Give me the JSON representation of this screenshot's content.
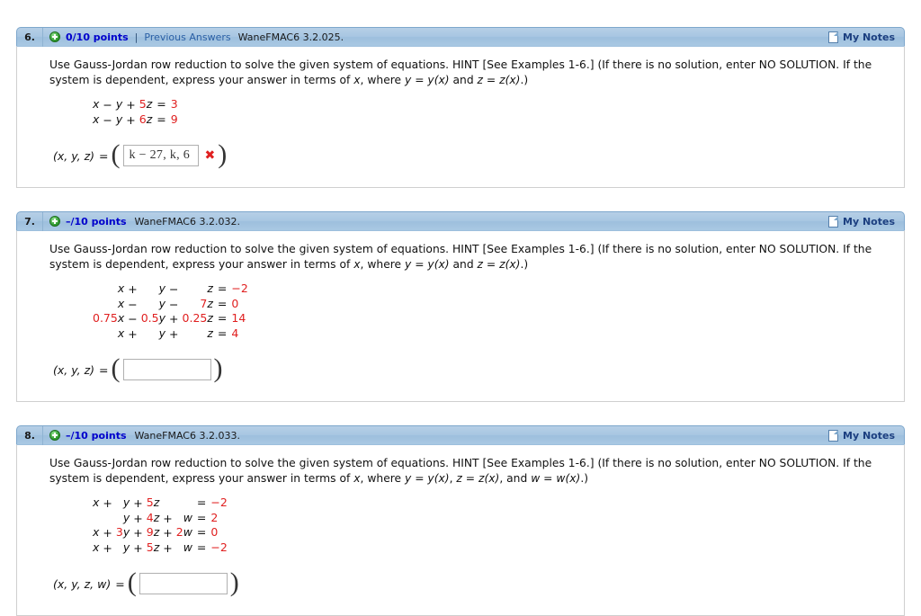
{
  "colors": {
    "header_blue": "#a8c6e2",
    "points_blue": "#0000cc",
    "link_blue": "#2a5fa5",
    "equation_red": "#e02020",
    "notes_blue": "#1c3f80"
  },
  "problems": [
    {
      "number": "6.",
      "points": "0/10 points",
      "separator": "|",
      "previous_answers": "Previous Answers",
      "question_key": "WaneFMAC6 3.2.025.",
      "notes_label": "My Notes",
      "notes_icon": "page-icon",
      "status_icon": "plus-circle-icon",
      "prompt_line1": "Use Gauss-Jordan row reduction to solve the given system of equations. HINT [See Examples 1-6.] (If there is no solution, enter NO SOLUTION. If the system is dependent,",
      "prompt_line2_a": "express your answer in terms of ",
      "prompt_line2_x": "x",
      "prompt_line2_b": ", where  ",
      "prompt_line2_c": "y = y(x)",
      "prompt_line2_d": "  and  ",
      "prompt_line2_e": "z = z(x)",
      "prompt_line2_f": ".)",
      "equations": [
        {
          "terms": [
            {
              "coef": "",
              "var": "x"
            },
            {
              "op": "−",
              "coef": "",
              "var": "y"
            },
            {
              "op": "+",
              "coef": "5",
              "var": "z"
            }
          ],
          "rhs": "3"
        },
        {
          "terms": [
            {
              "coef": "",
              "var": "x"
            },
            {
              "op": "−",
              "coef": "",
              "var": "y"
            },
            {
              "op": "+",
              "coef": "6",
              "var": "z"
            }
          ],
          "rhs": "9"
        }
      ],
      "answer_label": "(x, y, z)",
      "answer_equals": "=",
      "answer_value": "k − 27, k, 6",
      "answer_placeholder": "",
      "answer_mark": "✖",
      "answer_correct": false
    },
    {
      "number": "7.",
      "points": "–/10 points",
      "separator": "",
      "previous_answers": "",
      "question_key": "WaneFMAC6 3.2.032.",
      "notes_label": "My Notes",
      "notes_icon": "page-icon",
      "status_icon": "plus-circle-icon",
      "prompt_line1": "Use Gauss-Jordan row reduction to solve the given system of equations. HINT [See Examples 1-6.] (If there is no solution, enter NO SOLUTION. If the system is dependent,",
      "prompt_line2_a": "express your answer in terms of ",
      "prompt_line2_x": "x",
      "prompt_line2_b": ", where  ",
      "prompt_line2_c": "y = y(x)",
      "prompt_line2_d": "  and  ",
      "prompt_line2_e": "z = z(x)",
      "prompt_line2_f": ".)",
      "equations": [
        {
          "terms": [
            {
              "coef": "",
              "var": "x"
            },
            {
              "op": "+",
              "coef": "",
              "var": "y"
            },
            {
              "op": "−",
              "coef": "",
              "var": "z"
            }
          ],
          "rhs": "−2"
        },
        {
          "terms": [
            {
              "coef": "",
              "var": "x"
            },
            {
              "op": "−",
              "coef": "",
              "var": "y"
            },
            {
              "op": "−",
              "coef": "7",
              "var": "z"
            }
          ],
          "rhs": "0"
        },
        {
          "terms": [
            {
              "coef": "0.75",
              "var": "x"
            },
            {
              "op": "−",
              "coef": "0.5",
              "var": "y"
            },
            {
              "op": "+",
              "coef": "0.25",
              "var": "z"
            }
          ],
          "rhs": "14"
        },
        {
          "terms": [
            {
              "coef": "",
              "var": "x"
            },
            {
              "op": "+",
              "coef": "",
              "var": "y"
            },
            {
              "op": "+",
              "coef": "",
              "var": "z"
            }
          ],
          "rhs": "4"
        }
      ],
      "answer_label": "(x, y, z)",
      "answer_equals": "=",
      "answer_value": "",
      "answer_placeholder": "",
      "answer_mark": "",
      "answer_correct": null
    },
    {
      "number": "8.",
      "points": "–/10 points",
      "separator": "",
      "previous_answers": "",
      "question_key": "WaneFMAC6 3.2.033.",
      "notes_label": "My Notes",
      "notes_icon": "page-icon",
      "status_icon": "plus-circle-icon",
      "prompt_line1": "Use Gauss-Jordan row reduction to solve the given system of equations. HINT [See Examples 1-6.] (If there is no solution, enter NO SOLUTION. If the system is dependent,",
      "prompt_line2_a": "express your answer in terms of ",
      "prompt_line2_x": "x",
      "prompt_line2_b": ", where  ",
      "prompt_line2_c": "y = y(x)",
      "prompt_line2_d": ",   ",
      "prompt_line2_e": "z = z(x)",
      "prompt_line2_g": ",  and  ",
      "prompt_line2_h": "w = w(x)",
      "prompt_line2_f": ".)",
      "equations": [
        {
          "terms": [
            {
              "coef": "",
              "var": "x"
            },
            {
              "op": "+",
              "coef": "",
              "var": "y"
            },
            {
              "op": "+",
              "coef": "5",
              "var": "z"
            },
            {
              "op": "",
              "coef": "",
              "var": ""
            }
          ],
          "rhs": "−2"
        },
        {
          "terms": [
            {
              "coef": "",
              "var": ""
            },
            {
              "op": "",
              "coef": "",
              "var": "y"
            },
            {
              "op": "+",
              "coef": "4",
              "var": "z"
            },
            {
              "op": "+",
              "coef": "",
              "var": "w"
            }
          ],
          "rhs": "2"
        },
        {
          "terms": [
            {
              "coef": "",
              "var": "x"
            },
            {
              "op": "+",
              "coef": "3",
              "var": "y"
            },
            {
              "op": "+",
              "coef": "9",
              "var": "z"
            },
            {
              "op": "+",
              "coef": "2",
              "var": "w"
            }
          ],
          "rhs": "0"
        },
        {
          "terms": [
            {
              "coef": "",
              "var": "x"
            },
            {
              "op": "+",
              "coef": "",
              "var": "y"
            },
            {
              "op": "+",
              "coef": "5",
              "var": "z"
            },
            {
              "op": "+",
              "coef": "",
              "var": "w"
            }
          ],
          "rhs": "−2"
        }
      ],
      "answer_label": "(x, y, z, w)",
      "answer_equals": "=",
      "answer_value": "",
      "answer_placeholder": "",
      "answer_mark": "",
      "answer_correct": null
    }
  ]
}
